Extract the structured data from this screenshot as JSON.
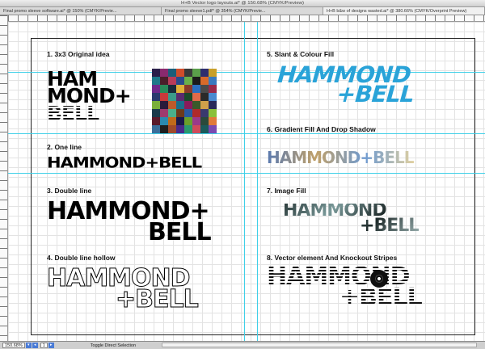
{
  "window": {
    "title": "H+B Vector logo layouts.ai* @ 150.68% (CMYK/Preview)"
  },
  "tabs": [
    {
      "label": "Final promo sleeve software.ai* @ 150% (CMYK/Previe..."
    },
    {
      "label": "Final promo sleeve1.pdf* @ 354% (CMYK/Previe..."
    },
    {
      "label": "H+B b&w of designs wasted.ai* @ 380.66% (CMYK/Overprint Preview)"
    }
  ],
  "sections": {
    "s1": "1. 3x3 Original idea",
    "s2": "2. One line",
    "s3": "3. Double line",
    "s4": "4. Double line hollow",
    "s5": "5. Slant & Colour Fill",
    "s6": "6. Gradient Fill And Drop Shadow",
    "s7": "7. Image Fill",
    "s8": "8. Vector element And Knockout Stripes"
  },
  "logo": {
    "hammond": "HAMMOND",
    "plus": "+",
    "bell": "BELL",
    "one_line": "HAMMOND+BELL",
    "ham": "HAM",
    "mond": "MOND+",
    "bell3": "BELL"
  },
  "status": {
    "zoom": "150.68%",
    "page": "1",
    "mode": "Toggle Direct Selection"
  },
  "colors": {
    "guide": "#3fd0e8",
    "blue": "#2aa3d8"
  }
}
